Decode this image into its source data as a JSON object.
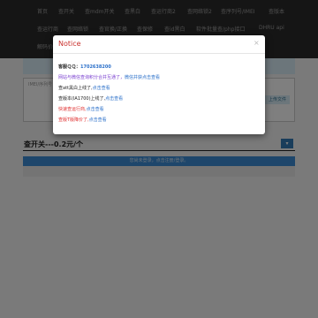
{
  "nav": {
    "row1": [
      "首页",
      "查开关",
      "查mdm开关",
      "查黑白",
      "查运行商2",
      "查网络锁2",
      "查序列号/IMEI",
      "查版本"
    ],
    "row2": [
      "查运行商",
      "查网络锁",
      "查官换/正换",
      "查保修",
      "查id黑白",
      "软件批量查/php接口",
      "DHRU api"
    ],
    "row3": [
      "解码价格"
    ]
  },
  "page": {
    "textarea_placeholder": "IMEI/序列号",
    "upload_label": "上传文件",
    "section_title": "查开关---0.2元/个",
    "dropdown_icon": "▾",
    "login_notice": "您尚未登录，点击注册/登录。"
  },
  "modal": {
    "title": "Notice",
    "close": "×",
    "qq_label": "客服ＱＱ：",
    "qq_number": "1702638200",
    "lines": [
      {
        "text": "网站与微信查询积分合并互通了，",
        "link": "微信并获点击查看",
        "color": "#7a3fd0"
      },
      {
        "text": "查att黑白上线了,",
        "link": "点击查看",
        "color": "#222222"
      },
      {
        "text": "查版本(IA1700)上线了,",
        "link": "点击查看",
        "color": "#222222"
      },
      {
        "text": "快速查运行商,",
        "link": "点击查看",
        "color": "#e03030"
      },
      {
        "text": "查版T版降价了,",
        "link": "点击查看",
        "color": "#e03030"
      }
    ]
  },
  "colors": {
    "navbar": "#2a2a2a",
    "primary": "#337ab7",
    "title_red": "#c9302c"
  }
}
